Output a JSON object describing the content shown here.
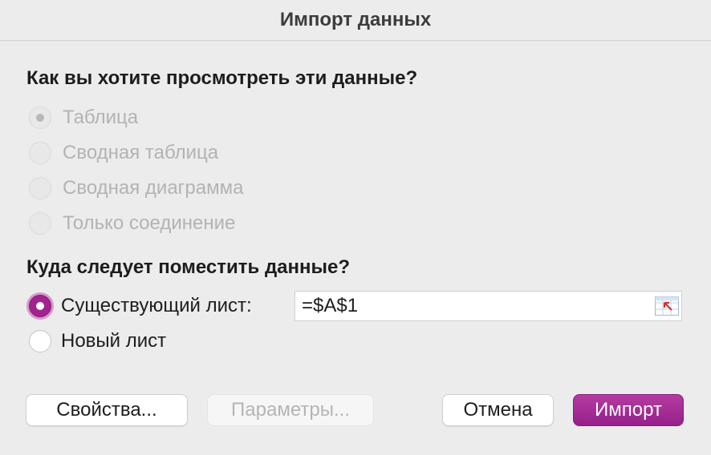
{
  "dialog": {
    "title": "Импорт данных"
  },
  "view": {
    "heading": "Как вы хотите просмотреть эти данные?",
    "options": [
      {
        "label": "Таблица",
        "selected": true,
        "enabled": false
      },
      {
        "label": "Сводная таблица",
        "selected": false,
        "enabled": false
      },
      {
        "label": "Сводная диаграмма",
        "selected": false,
        "enabled": false
      },
      {
        "label": "Только соединение",
        "selected": false,
        "enabled": false
      }
    ]
  },
  "destination": {
    "heading": "Куда следует поместить данные?",
    "existing_sheet_label": "Существующий лист:",
    "existing_sheet_selected": true,
    "cell_reference": "=$A$1",
    "new_sheet_label": "Новый лист",
    "new_sheet_selected": false
  },
  "buttons": {
    "properties": "Свойства...",
    "parameters": "Параметры...",
    "cancel": "Отмена",
    "import": "Импорт"
  },
  "colors": {
    "accent": "#a2238f",
    "background": "#ececec",
    "disabled_text": "#b3b3b3"
  },
  "icons": {
    "collapse_dialog": "range-select-icon"
  }
}
